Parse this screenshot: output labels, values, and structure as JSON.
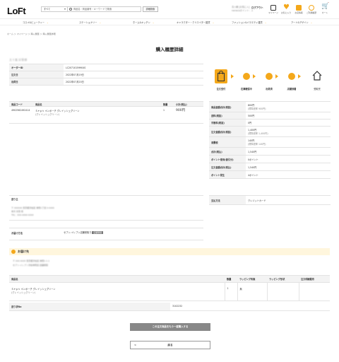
{
  "header": {
    "logo": "LoFt",
    "category_select": "すべて",
    "search_placeholder": "商品名・商品番号・キーワードで検索",
    "search_button": "詳細検索",
    "greeting": "青○様 [お気に入]\nnanacoポイント：エラー",
    "logout": "ログアウト",
    "icons": [
      {
        "name": "user-icon",
        "label": "マイページ"
      },
      {
        "name": "heart-icon",
        "label": "お気に入り"
      },
      {
        "name": "shop-icon",
        "label": "お店情報"
      },
      {
        "name": "history-icon",
        "label": "ご利用履歴"
      },
      {
        "name": "cart-icon",
        "label": "カート"
      }
    ]
  },
  "nav": [
    "コスメ&ビューティー",
    "ステーショナリー",
    "ホーム&キッチン",
    "キャラクター・クリエイター雑貨",
    "ファッション&バラエティ雑貨",
    "アート&デザイン"
  ],
  "breadcrumb": "ホーム ＞ マイページ ＞ 購入履歴 ＞ 購入履歴詳細",
  "page_title": "購入履歴詳細",
  "customer_name": "五十嵐 好恵様",
  "order_info": [
    {
      "label": "オーダーID",
      "value": "LC20710159904S"
    },
    {
      "label": "注文日",
      "value": "2022年07月19日"
    },
    {
      "label": "出荷日",
      "value": "2022年07月20日"
    }
  ],
  "items_table": {
    "headers": [
      "商品コード",
      "商品名",
      "数量",
      "小計(税込)"
    ],
    "rows": [
      {
        "code": "4902562492414",
        "name": "Ｓｅｐｔ ペンポーチ グレイッシュグリーン",
        "sub": "(グレイッシュグリーン)",
        "qty": "1",
        "price": "900円"
      }
    ]
  },
  "status_steps": [
    {
      "label": "注文受付",
      "active": true
    },
    {
      "label": "在庫確保中"
    },
    {
      "label": "出荷済"
    },
    {
      "label": "店舗到着"
    },
    {
      "label": "受取完"
    }
  ],
  "price_table": [
    {
      "label": "商品金額合計(税抜)",
      "value": "800円",
      "sub": "(標準税率 900円)"
    },
    {
      "label": "送料(税抜)",
      "value": "500円"
    },
    {
      "label": "手数料(税抜)",
      "value": "0円"
    },
    {
      "label": "注文金額合計(税抜)",
      "value": "1,400円",
      "sub": "(標準税率 1,400円)"
    },
    {
      "label": "消費税",
      "value": "140円",
      "sub": "(標準税率 140円)"
    },
    {
      "label": "合計(税込)",
      "value": "1,540円"
    },
    {
      "label": "ポイント使用(値引分)",
      "value": "0ポイント"
    },
    {
      "label": "注文金額合計(税込)",
      "value": "1,540円"
    },
    {
      "label": "ポイント発生",
      "value": "4ポイント"
    }
  ],
  "payment": {
    "label": "支払方法",
    "value": "クレジットカード"
  },
  "sender": {
    "label": "送り主",
    "lines": [
      "〒 000000 東京都渋谷区 神南1丁目 0-0000",
      "青木 好恵 様",
      "TEL：000-0000-0000"
    ]
  },
  "receive": {
    "label": "お届け方法",
    "value": "セブン-イレブン店舗受取り",
    "tag": "店舗受取"
  },
  "destination": {
    "title": "お届け先",
    "lines": [
      "〒 000-0000 東京都渋谷区 神南1-1-1",
      "セブン-イレブン渋谷神南店 店舗受取"
    ]
  },
  "ship_table": {
    "headers": [
      "商品名",
      "数量",
      "ラッピング有無",
      "ラッピング形状",
      "注文明細配布"
    ],
    "rows": [
      {
        "name": "Ｓｅｐｔ ペンポーチ グレイッシュグリーン",
        "sub": "(グレイッシュグリーン)",
        "qty": "1",
        "wrap": "無",
        "shape": "",
        "slip": ""
      }
    ]
  },
  "tracking": {
    "label": "送り状No",
    "value": "3102232"
  },
  "buttons": {
    "reorder": "この注文商品をもう一度購入する",
    "back": "戻る"
  }
}
